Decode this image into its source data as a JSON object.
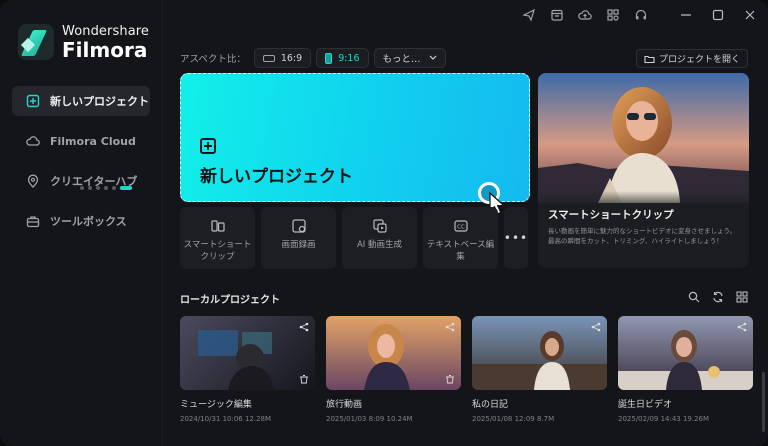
{
  "app": {
    "brand_line1": "Wondershare",
    "brand_line2": "Filmora"
  },
  "sidebar": {
    "items": [
      {
        "label": "新しいプロジェクト",
        "icon": "new-project-icon",
        "active": true
      },
      {
        "label": "Filmora Cloud",
        "icon": "cloud-icon",
        "active": false
      },
      {
        "label": "クリエイターハブ",
        "icon": "location-pin-icon",
        "active": false
      },
      {
        "label": "ツールボックス",
        "icon": "toolbox-icon",
        "active": false
      }
    ]
  },
  "topbar": {
    "icons": [
      "send-icon",
      "calendar-icon",
      "cloud-upload-icon",
      "grid-icon",
      "headset-icon"
    ],
    "window_controls": [
      "minimize-icon",
      "maximize-icon",
      "close-icon"
    ]
  },
  "aspect": {
    "label": "アスペクト比：",
    "options": [
      "16:9",
      "9:16"
    ],
    "selected": "9:16",
    "more_label": "もっと…"
  },
  "open_project_label": "プロジェクトを開く",
  "new_project": {
    "title": "新しいプロジェクト",
    "accent": "#12f0e8"
  },
  "tools": [
    {
      "label": "スマートショートクリップ",
      "icon": "smart-clip-icon"
    },
    {
      "label": "画面録画",
      "icon": "screen-record-icon"
    },
    {
      "label": "AI 動画生成",
      "icon": "ai-video-icon"
    },
    {
      "label": "テキストベース編集",
      "icon": "cc-icon"
    }
  ],
  "more_tools_label": "•••",
  "smart_clip": {
    "title": "スマートショートクリップ",
    "description": "長い動画を簡単に魅力的なショートビデオに変身させましょう。最高の瞬間をカット、トリミング、ハイライトしましょう！",
    "slides": 6,
    "active_slide": 5
  },
  "local_projects": {
    "title": "ローカルプロジェクト",
    "items": [
      {
        "name": "ミュージック編集",
        "meta": "2024/10/31 10:06  12.28M",
        "colors": [
          "#3b3a4a",
          "#1a1b22"
        ]
      },
      {
        "name": "旅行動画",
        "meta": "2025/01/03 8:09  10.24M",
        "colors": [
          "#e0a06a",
          "#5a4060"
        ]
      },
      {
        "name": "私の日記",
        "meta": "2025/01/08 12:09  8.7M",
        "colors": [
          "#6a86a8",
          "#3a3430"
        ]
      },
      {
        "name": "誕生日ビデオ",
        "meta": "2025/02/09 14:43  19.26M",
        "colors": [
          "#8a90a8",
          "#3a3040"
        ]
      }
    ]
  }
}
